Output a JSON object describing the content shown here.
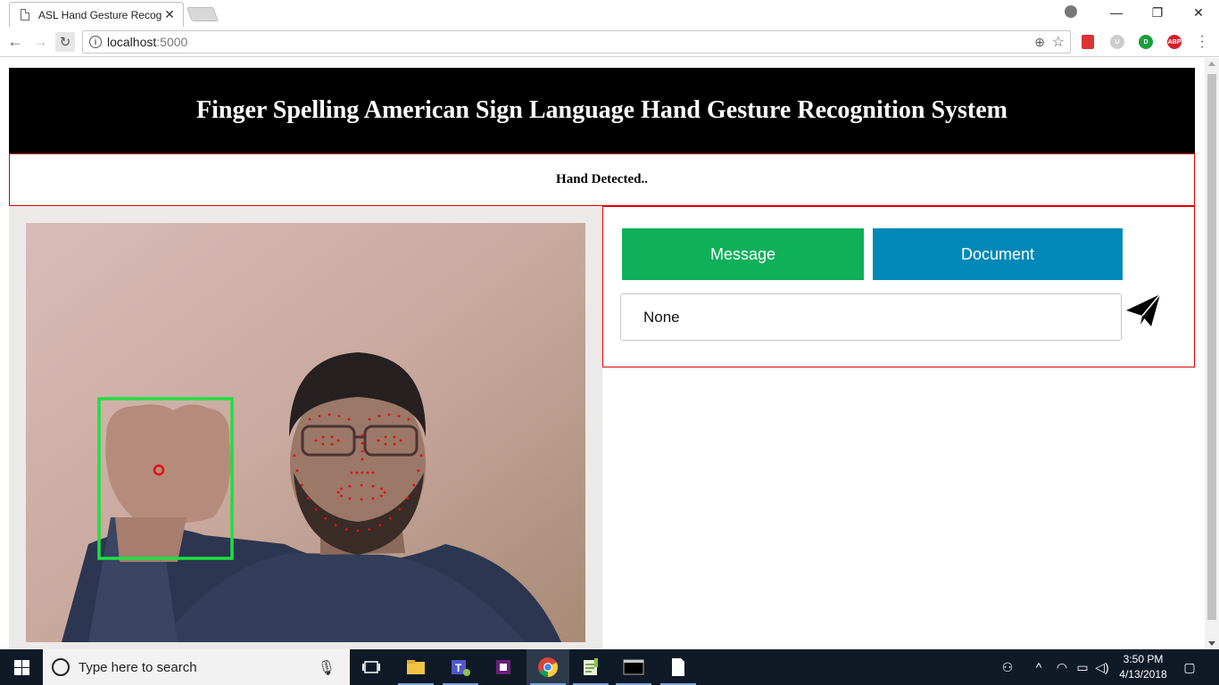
{
  "browser": {
    "tab_title": "ASL Hand Gesture Recog",
    "tab_close": "✕",
    "url_host": "localhost",
    "url_port": ":5000",
    "win_minimize": "—",
    "win_restore": "❐",
    "win_close": "✕",
    "extensions": {
      "u": "U",
      "d": "D",
      "abp": "ABP"
    }
  },
  "page": {
    "title": "Finger Spelling American Sign Language Hand Gesture Recognition System",
    "status": "Hand Detected.."
  },
  "controls": {
    "message_label": "Message",
    "document_label": "Document",
    "input_value": "None",
    "accent_message": "#0fb05a",
    "accent_document": "#0088b8"
  },
  "taskbar": {
    "search_placeholder": "Type here to search",
    "time": "3:50 PM",
    "date": "4/13/2018"
  },
  "icons": [
    "page-icon",
    "profile-icon",
    "back-icon",
    "forward-icon",
    "reload-icon",
    "info-icon",
    "zoom-icon",
    "star-icon",
    "send-icon",
    "windows-icon",
    "cortana-icon",
    "mic-icon"
  ]
}
